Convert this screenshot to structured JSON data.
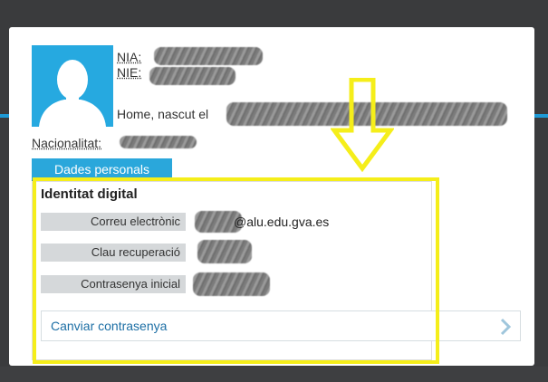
{
  "profile": {
    "nia_label": "NIA:",
    "nie_label": "NIE:",
    "born_text": "Home, nascut el",
    "nationality_label": "Nacionalitat:"
  },
  "tabs": {
    "personal": "Dades personals"
  },
  "digital_identity": {
    "title": "Identitat digital",
    "fields": [
      {
        "label": "Correu electrònic",
        "value": "@alu.edu.gva.es"
      },
      {
        "label": "Clau recuperació",
        "value": ""
      },
      {
        "label": "Contrasenya inicial",
        "value": ""
      }
    ],
    "change_password": "Canviar contrasenya"
  },
  "icons": {
    "avatar": "user-silhouette-icon",
    "chevron": "chevron-right-icon",
    "annotation_arrow": "down-arrow-icon"
  },
  "colors": {
    "accent": "#26a9e0",
    "highlight": "#f5ee1a",
    "background": "#3a3b3d"
  }
}
